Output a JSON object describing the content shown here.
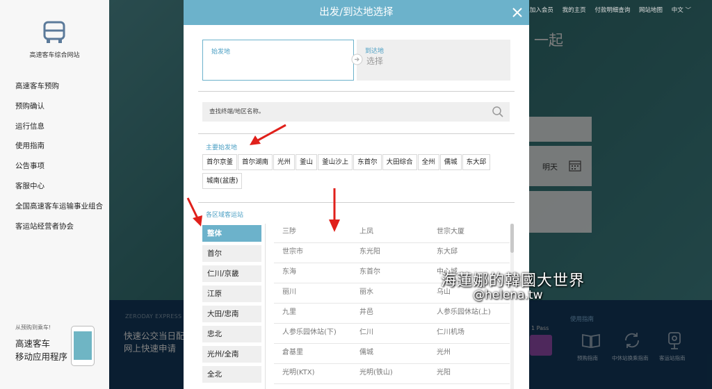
{
  "sidebar": {
    "site_name": "高速客车综合网站",
    "nav": [
      "高速客车预购",
      "预购确认",
      "运行信息",
      "使用指南",
      "公告事项",
      "客服中心",
      "全国高速客车运输事业组合",
      "客运站经营者协会"
    ],
    "app_small": "从预购到乘车!",
    "app_title_1": "高速客车",
    "app_title_2": "移动应用程序"
  },
  "topnav": [
    "加入会员",
    "我的主页",
    "付款明细查询",
    "网站地图",
    "中文"
  ],
  "hero": {
    "phrase": "一起",
    "tomorrow": "明天",
    "strip_label": "ZERODAY EXPRESS",
    "strip_line1": "快速公交当日配",
    "strip_line2": "网上快速申请",
    "pass_text": "1 Pass",
    "guide_title": "使用指南",
    "guide_icons": [
      {
        "label": "预购指南",
        "icon": "book-icon"
      },
      {
        "label": "中休站换乘指南",
        "icon": "refresh-icon"
      },
      {
        "label": "客运站指南",
        "icon": "map-pin-icon"
      }
    ]
  },
  "modal": {
    "title": "出发/到达地选择",
    "departure_label": "始发地",
    "departure_value": "",
    "arrival_label": "到达地",
    "arrival_value": "选择",
    "search_placeholder": "查找终端/地区名称。",
    "main_title": "主要始发地",
    "main_terminals": [
      "首尔京釜",
      "首尔湖南",
      "光州",
      "釜山",
      "釜山沙上",
      "东首尔",
      "大田综合",
      "全州",
      "儒城",
      "东大邱",
      "城南(盆唐)"
    ],
    "region_title": "各区域客运站",
    "regions": [
      "整体",
      "首尔",
      "仁川/京畿",
      "江原",
      "大田/忠南",
      "忠北",
      "光州/全南",
      "全北"
    ],
    "active_region": "整体",
    "stations": [
      [
        "三陟",
        "上凤",
        "世宗大厦"
      ],
      [
        "世宗市",
        "东光阳",
        "东大邱"
      ],
      [
        "东海",
        "东首尔",
        "中心城"
      ],
      [
        "丽川",
        "丽水",
        "乌山"
      ],
      [
        "九里",
        "井邑",
        "人参乐园休站(上)"
      ],
      [
        "人参乐园休站(下)",
        "仁川",
        "仁川机场"
      ],
      [
        "倉基里",
        "儒城",
        "光州"
      ],
      [
        "光明(KTX)",
        "光明(铁山)",
        "光阳"
      ]
    ]
  },
  "watermark": {
    "line1": "海蓮娜的韓國大世界",
    "line2": "@helena.tw"
  },
  "colors": {
    "accent": "#6cb2cb",
    "annotation": "#e0201b",
    "strip": "#13385a"
  }
}
